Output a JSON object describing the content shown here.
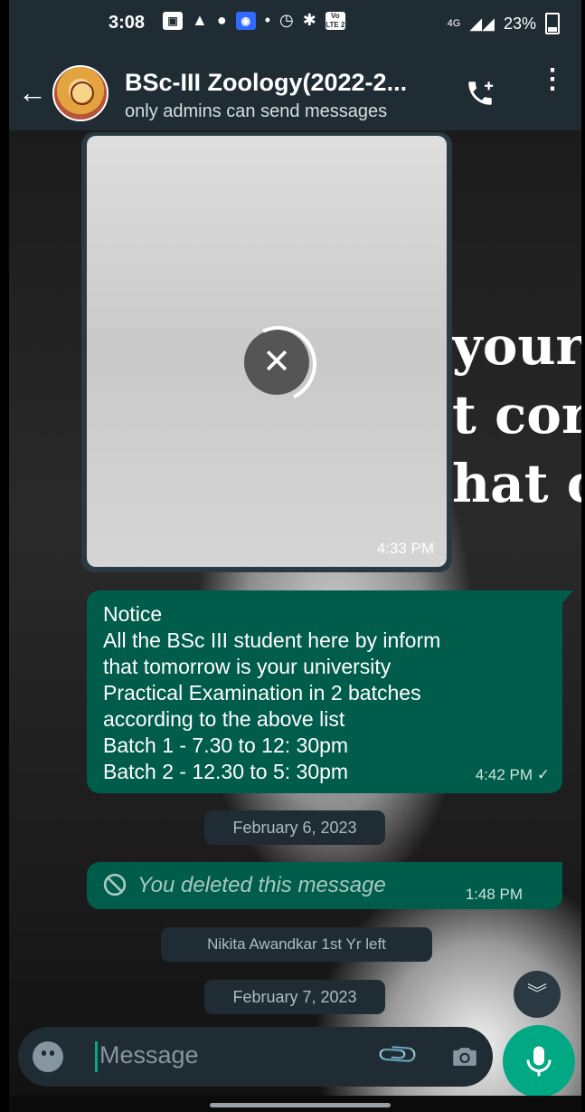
{
  "status_bar": {
    "time": "3:08",
    "battery": "23%",
    "network": "4G",
    "volte": "Vo LTE 2"
  },
  "header": {
    "title": "BSc-III Zoology(2022-2...",
    "subtitle": "only admins can send messages",
    "back_icon": "arrow-left-icon",
    "call_icon": "add-call-icon",
    "menu_icon": "more-vertical-icon"
  },
  "wallpaper": {
    "lines": [
      "your",
      "t cor",
      "hat c"
    ]
  },
  "messages": [
    {
      "type": "media",
      "time": "4:33 PM",
      "state": "downloading-cancelable"
    },
    {
      "type": "text",
      "text": "Notice\nAll the BSc III  student here by inform\nthat tomorrow is your university\nPractical Examination in 2 batches\naccording to the above list\nBatch 1 - 7.30 to 12: 30pm\nBatch 2 - 12.30 to 5: 30pm",
      "time": "4:42 PM ✓"
    }
  ],
  "date_chips": {
    "first": "February 6, 2023",
    "second": "February 7, 2023"
  },
  "deleted_message": {
    "text": "You deleted this message",
    "time": "1:48 PM"
  },
  "system_message": "Nikita Awandkar 1st Yr left",
  "composer": {
    "placeholder": "Message"
  },
  "colors": {
    "header_bg": "#1f2c34",
    "outgoing_bubble": "#005c4b",
    "accent": "#00a884"
  }
}
